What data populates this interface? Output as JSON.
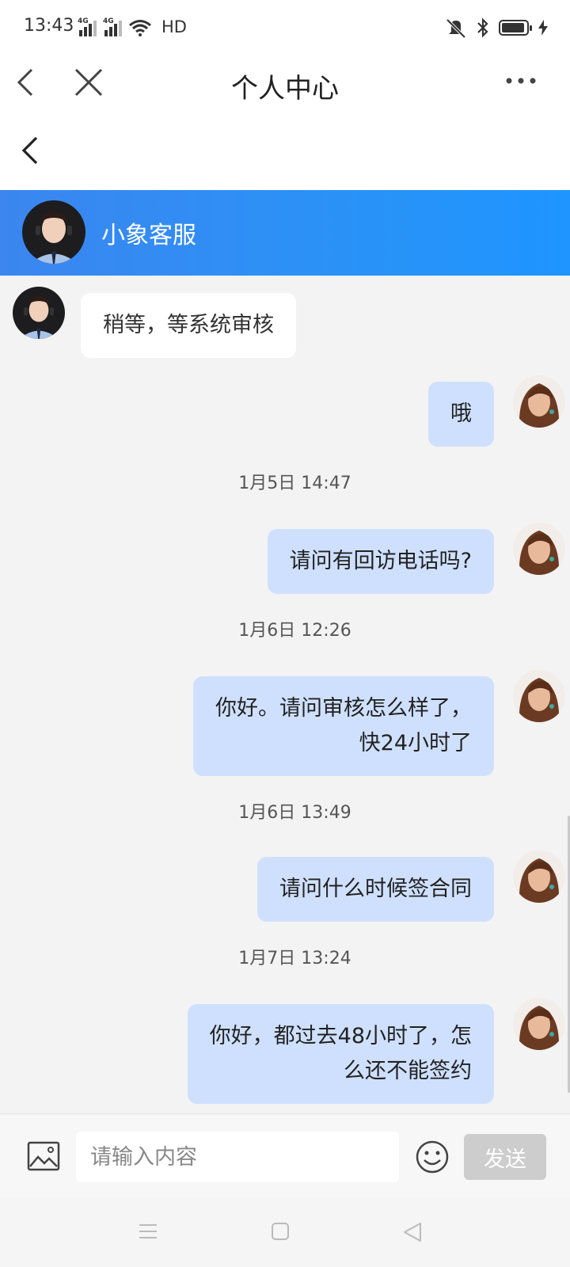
{
  "status_bar": {
    "time": "13:43",
    "network_labels": [
      "4G",
      "4G"
    ],
    "hd_label": "HD",
    "icons": [
      "signal-icon",
      "signal-icon",
      "wifi-icon",
      "mute-vibrate-icon",
      "bluetooth-icon",
      "battery-icon",
      "charging-icon"
    ]
  },
  "top_nav": {
    "title": "个人中心",
    "icons": [
      "back-icon",
      "close-icon",
      "more-icon"
    ]
  },
  "chat_header": {
    "agent_name": "小象客服"
  },
  "messages": [
    {
      "type": "bubble",
      "side": "left",
      "lines": [
        "稍等，等系统审核"
      ]
    },
    {
      "type": "bubble",
      "side": "right",
      "lines": [
        "哦"
      ]
    },
    {
      "type": "time",
      "text": "1月5日 14:47"
    },
    {
      "type": "bubble",
      "side": "right",
      "lines": [
        "请问有回访电话吗?"
      ]
    },
    {
      "type": "time",
      "text": "1月6日 12:26"
    },
    {
      "type": "bubble",
      "side": "right",
      "lines": [
        "你好。请问审核怎么样了，",
        "快24小时了"
      ]
    },
    {
      "type": "time",
      "text": "1月6日 13:49"
    },
    {
      "type": "bubble",
      "side": "right",
      "lines": [
        "请问什么时候签合同"
      ]
    },
    {
      "type": "time",
      "text": "1月7日 13:24"
    },
    {
      "type": "bubble",
      "side": "right",
      "lines": [
        "你好，都过去48小时了，怎",
        "么还不能签约"
      ]
    }
  ],
  "input_bar": {
    "placeholder": "请输入内容",
    "value": "",
    "send_label": "发送"
  },
  "colors": {
    "header_gradient_start": "#3b86ef",
    "header_gradient_end": "#1e95ff",
    "right_bubble": "#cfe0ff",
    "left_bubble": "#ffffff",
    "send_disabled": "#cdcdcd"
  }
}
